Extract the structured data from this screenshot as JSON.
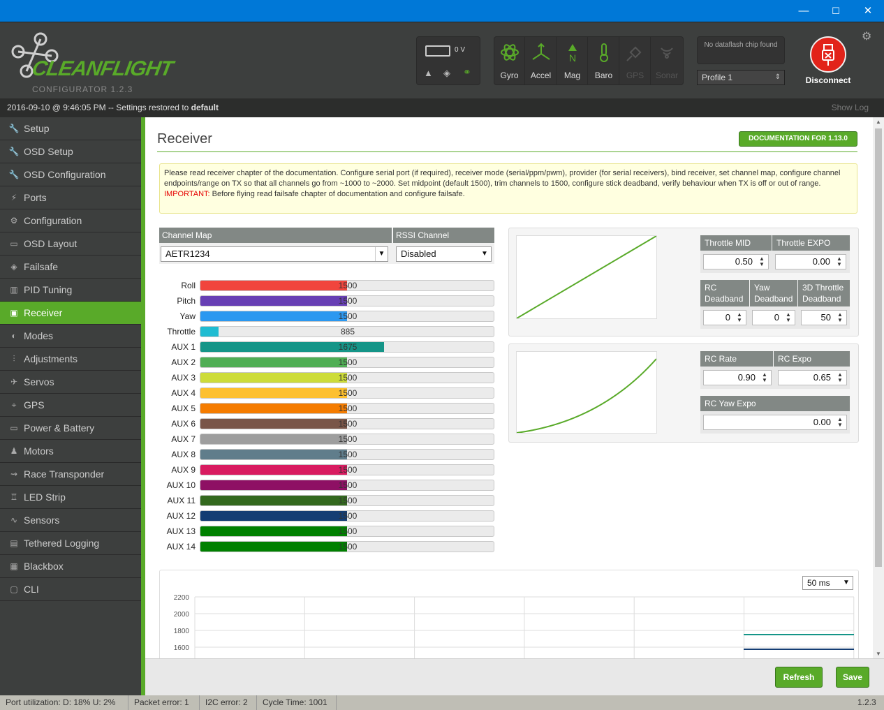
{
  "window": {
    "minimize": "—",
    "maximize": "☐",
    "close": "✕"
  },
  "header": {
    "logo_text": "CLEANFLIGHT",
    "logo_sub": "CONFIGURATOR  1.2.3",
    "battery": "0 V",
    "sensors": [
      {
        "label": "Gyro",
        "active": true
      },
      {
        "label": "Accel",
        "active": true
      },
      {
        "label": "Mag",
        "active": true
      },
      {
        "label": "Baro",
        "active": true
      },
      {
        "label": "GPS",
        "active": false
      },
      {
        "label": "Sonar",
        "active": false
      }
    ],
    "dataflash": "No dataflash chip found",
    "profile": "Profile 1",
    "disconnect": "Disconnect"
  },
  "statusline": {
    "date": "2016-09-10 @ 9:46:05 PM -- Settings restored to ",
    "bold": "default",
    "show_log": "Show Log"
  },
  "sidebar": {
    "items": [
      {
        "label": "Setup",
        "icon": "wrench-icon",
        "glyph": "🔧"
      },
      {
        "label": "OSD Setup",
        "icon": "wrench-icon",
        "glyph": "🔧"
      },
      {
        "label": "OSD Configuration",
        "icon": "wrench-icon",
        "glyph": "🔧"
      },
      {
        "label": "Ports",
        "icon": "plug-icon",
        "glyph": "⚡"
      },
      {
        "label": "Configuration",
        "icon": "gear-icon",
        "glyph": "⚙"
      },
      {
        "label": "OSD Layout",
        "icon": "osd-icon",
        "glyph": "▭"
      },
      {
        "label": "Failsafe",
        "icon": "parachute-icon",
        "glyph": "◈"
      },
      {
        "label": "PID Tuning",
        "icon": "pid-icon",
        "glyph": "▥"
      },
      {
        "label": "Receiver",
        "icon": "receiver-icon",
        "glyph": "▣",
        "active": true
      },
      {
        "label": "Modes",
        "icon": "modes-icon",
        "glyph": "◐"
      },
      {
        "label": "Adjustments",
        "icon": "sliders-icon",
        "glyph": "⫶"
      },
      {
        "label": "Servos",
        "icon": "servo-icon",
        "glyph": "✈"
      },
      {
        "label": "GPS",
        "icon": "satellite-icon",
        "glyph": "⌖"
      },
      {
        "label": "Power & Battery",
        "icon": "battery-icon",
        "glyph": "▭"
      },
      {
        "label": "Motors",
        "icon": "motor-icon",
        "glyph": "♟"
      },
      {
        "label": "Race Transponder",
        "icon": "transponder-icon",
        "glyph": "⇝"
      },
      {
        "label": "LED Strip",
        "icon": "led-icon",
        "glyph": "♖"
      },
      {
        "label": "Sensors",
        "icon": "sensors-icon",
        "glyph": "∿"
      },
      {
        "label": "Tethered Logging",
        "icon": "logging-icon",
        "glyph": "▤"
      },
      {
        "label": "Blackbox",
        "icon": "blackbox-icon",
        "glyph": "▦"
      },
      {
        "label": "CLI",
        "icon": "cli-icon",
        "glyph": "▢"
      }
    ]
  },
  "receiver": {
    "title": "Receiver",
    "doc_button": "DOCUMENTATION FOR 1.13.0",
    "note": "Please read receiver chapter of the documentation. Configure serial port (if required), receiver mode (serial/ppm/pwm), provider (for serial receivers), bind receiver, set channel map, configure channel endpoints/range on TX so that all channels go from ~1000 to ~2000. Set midpoint (default 1500), trim channels to 1500, configure stick deadband, verify behaviour when TX is off or out of range.",
    "important_label": "IMPORTANT:",
    "important_text": " Before flying read failsafe chapter of documentation and configure failsafe.",
    "channel_map_label": "Channel Map",
    "channel_map_value": "AETR1234",
    "rssi_label": "RSSI Channel",
    "rssi_value": "Disabled",
    "channels": [
      {
        "name": "Roll",
        "value": 1500,
        "color": "#f1453d"
      },
      {
        "name": "Pitch",
        "value": 1500,
        "color": "#673fb4"
      },
      {
        "name": "Yaw",
        "value": 1500,
        "color": "#2b98f0"
      },
      {
        "name": "Throttle",
        "value": 885,
        "color": "#1fbcd2"
      },
      {
        "name": "AUX 1",
        "value": 1675,
        "color": "#159588"
      },
      {
        "name": "AUX 2",
        "value": 1500,
        "color": "#50ae55"
      },
      {
        "name": "AUX 3",
        "value": 1500,
        "color": "#cddc39"
      },
      {
        "name": "AUX 4",
        "value": 1500,
        "color": "#fdc02f"
      },
      {
        "name": "AUX 5",
        "value": 1500,
        "color": "#f57c00"
      },
      {
        "name": "AUX 6",
        "value": 1500,
        "color": "#795548"
      },
      {
        "name": "AUX 7",
        "value": 1500,
        "color": "#9e9e9e"
      },
      {
        "name": "AUX 8",
        "value": 1500,
        "color": "#607d8b"
      },
      {
        "name": "AUX 9",
        "value": 1500,
        "color": "#d81b60"
      },
      {
        "name": "AUX 10",
        "value": 1500,
        "color": "#8e1064"
      },
      {
        "name": "AUX 11",
        "value": 1500,
        "color": "#33691e"
      },
      {
        "name": "AUX 12",
        "value": 1500,
        "color": "#143d73"
      },
      {
        "name": "AUX 13",
        "value": 1500,
        "color": "#008000"
      },
      {
        "name": "AUX 14",
        "value": 1500,
        "color": "#008000"
      }
    ],
    "throttle": {
      "mid_label": "Throttle MID",
      "mid": "0.50",
      "expo_label": "Throttle EXPO",
      "expo": "0.00"
    },
    "deadband": {
      "rc_label_1": "RC",
      "rc_label_2": "Deadband",
      "rc": "0",
      "yaw_label_1": "Yaw",
      "yaw_label_2": "Deadband",
      "yaw": "0",
      "d3_label_1": "3D Throttle",
      "d3_label_2": "Deadband",
      "d3": "50"
    },
    "rates": {
      "rate_label": "RC Rate",
      "rate": "0.90",
      "expo_label": "RC Expo",
      "expo": "0.65",
      "yaw_expo_label": "RC Yaw Expo",
      "yaw_expo": "0.00"
    },
    "graph": {
      "interval": "50 ms",
      "y_ticks": [
        "2200",
        "2000",
        "1800",
        "1600"
      ]
    },
    "refresh": "Refresh",
    "save": "Save"
  },
  "footer": {
    "port": "Port utilization: D: 18% U: 2%",
    "packet": "Packet error: 1",
    "i2c": "I2C error: 2",
    "cycle": "Cycle Time: 1001",
    "version": "1.2.3"
  }
}
